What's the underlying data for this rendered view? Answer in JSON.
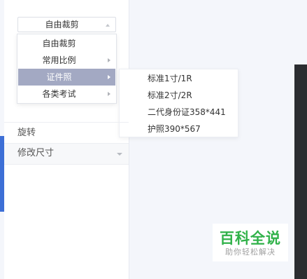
{
  "crop": {
    "selected": "自由裁剪",
    "menu_items": [
      {
        "label": "自由裁剪",
        "has_submenu": false
      },
      {
        "label": "常用比例",
        "has_submenu": true
      },
      {
        "label": "证件照",
        "has_submenu": true,
        "active": true
      },
      {
        "label": "各类考试",
        "has_submenu": true
      }
    ],
    "submenu_items": [
      {
        "label": "标准1寸/1R"
      },
      {
        "label": "标准2寸/2R"
      },
      {
        "label": "二代身份证358*441"
      },
      {
        "label": "护照390*567"
      }
    ]
  },
  "tools": {
    "rotate_label": "旋转",
    "resize_label": "修改尺寸"
  },
  "watermark": {
    "title": "百科全说",
    "subtitle": "助你轻松解决"
  },
  "colors": {
    "accent": "#3d6fd6",
    "menu_active": "#a3a9c3",
    "watermark_green": "#31b24a"
  }
}
